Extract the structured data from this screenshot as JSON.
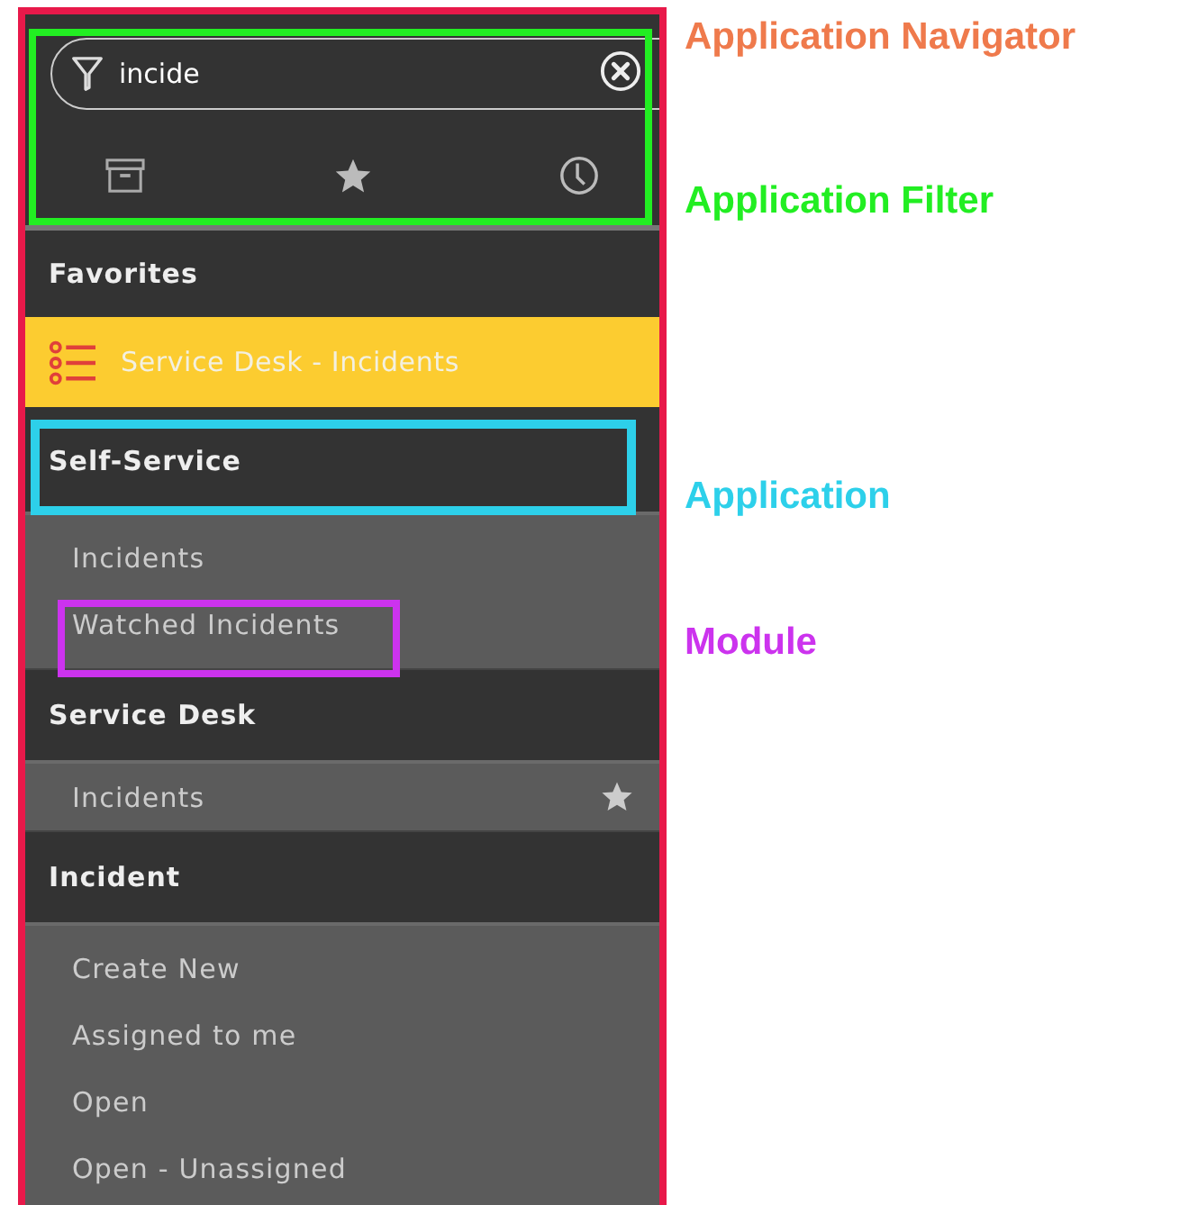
{
  "filter": {
    "value": "incide"
  },
  "favorites": {
    "title": "Favorites",
    "items": [
      {
        "label": "Service Desk - Incidents",
        "selected": true
      }
    ]
  },
  "applications": [
    {
      "title": "Self-Service",
      "modules": [
        {
          "label": "Incidents",
          "favorite": false
        },
        {
          "label": "Watched Incidents",
          "favorite": false
        }
      ]
    },
    {
      "title": "Service Desk",
      "modules": [
        {
          "label": "Incidents",
          "favorite": true
        }
      ]
    },
    {
      "title": "Incident",
      "modules": [
        {
          "label": "Create New",
          "favorite": false
        },
        {
          "label": "Assigned to me",
          "favorite": false
        },
        {
          "label": "Open",
          "favorite": false
        },
        {
          "label": "Open - Unassigned",
          "favorite": false
        }
      ]
    }
  ],
  "callouts": [
    {
      "kind": "navigator",
      "label": "Application Navigator",
      "color": "#ef7a4c"
    },
    {
      "kind": "filter",
      "label": "Application Filter",
      "color": "#22ee22"
    },
    {
      "kind": "application",
      "label": "Application",
      "color": "#2dd0ea"
    },
    {
      "kind": "module",
      "label": "Module",
      "color": "#cc33ee"
    }
  ]
}
